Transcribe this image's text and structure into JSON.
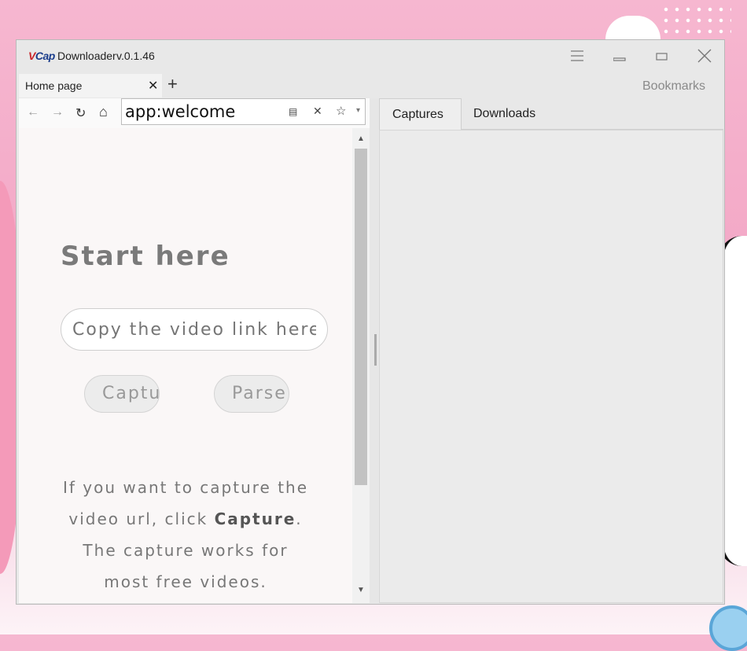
{
  "window": {
    "logo": {
      "v": "V",
      "cap": "Cap"
    },
    "app_name": "Downloader",
    "version": "v.0.1.46",
    "menu_icon": "☰",
    "minimize_icon": "▁",
    "maximize_icon": "▭",
    "close_icon": "✕"
  },
  "tabs": {
    "items": [
      {
        "label": "Home page",
        "close": "✕"
      }
    ],
    "add": "+",
    "bookmarks_label": "Bookmarks"
  },
  "nav": {
    "back": "←",
    "forward": "→",
    "reload": "↻",
    "home": "⌂",
    "address": "app:welcome",
    "copy_icon": "▤",
    "clear_icon": "✕",
    "star_icon": "☆",
    "dropdown_icon": "▾"
  },
  "welcome": {
    "title": "Start here",
    "link_placeholder": "Copy the video link here",
    "capture_button": "Capture",
    "parse_button": "Parse",
    "help_line1": "If you want to capture the",
    "help_line2_pre": "video url, click ",
    "help_line2_bold": "Capture",
    "help_line2_post": ".",
    "help_line3": "The capture works for",
    "help_line4": "most free videos."
  },
  "scrollbar": {
    "up": "▲",
    "down": "▼"
  },
  "right_panel": {
    "tabs": [
      {
        "label": "Captures"
      },
      {
        "label": "Downloads"
      }
    ]
  }
}
